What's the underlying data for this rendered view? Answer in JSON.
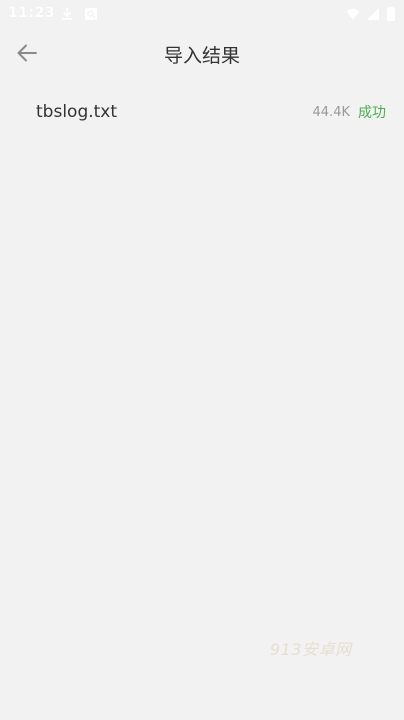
{
  "status_bar": {
    "time": "11:23",
    "icons": [
      "download-icon",
      "search-icon",
      "wifi-icon",
      "signal-icon",
      "battery-icon"
    ]
  },
  "app_bar": {
    "back_icon": "arrow-left-icon",
    "title": "导入结果"
  },
  "results": [
    {
      "file_name": "tbslog.txt",
      "size": "44.4K",
      "status": "成功"
    }
  ],
  "watermark": "913安卓网",
  "colors": {
    "background": "#f2f2f2",
    "text_primary": "#333333",
    "text_secondary": "#999999",
    "success": "#4caf50",
    "icon": "#8a8a8a"
  }
}
